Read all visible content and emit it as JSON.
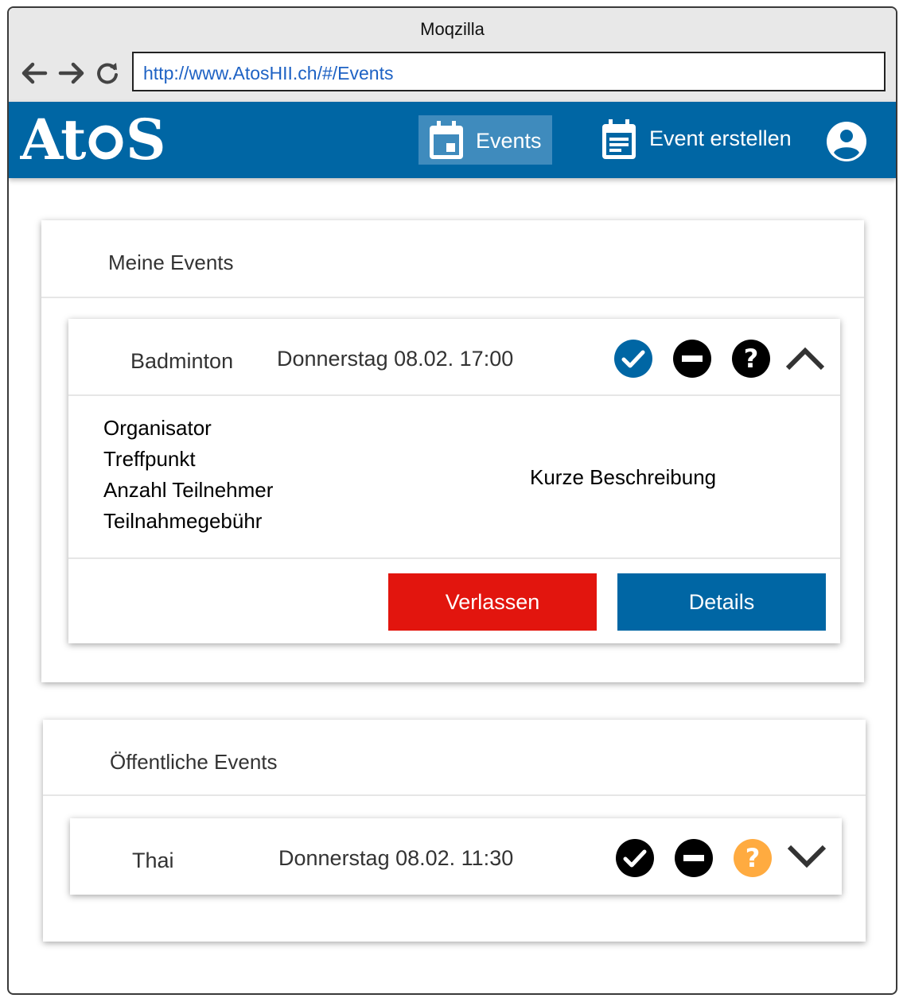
{
  "browser": {
    "title": "Moqzilla",
    "url": "http://www.AtosHII.ch/#/Events"
  },
  "app": {
    "logo_text": "AtoS",
    "nav": {
      "events_label": "Events",
      "create_label": "Event erstellen"
    },
    "colors": {
      "brand": "#0066a4",
      "active_tab": "#3f8bbd",
      "leave": "#e2150e",
      "maybe": "#ffab40"
    }
  },
  "my_events": {
    "title": "Meine Events",
    "event": {
      "name": "Badminton",
      "date": "Donnerstag 08.02. 17:00",
      "details": [
        "Organisator",
        "Treffpunkt",
        "Anzahl Teilnehmer",
        "Teilnahmegebühr"
      ],
      "description": "Kurze Beschreibung",
      "leave_label": "Verlassen",
      "details_label": "Details",
      "status": "accepted"
    }
  },
  "public_events": {
    "title": "Öffentliche Events",
    "event": {
      "name": "Thai",
      "date": "Donnerstag 08.02. 11:30",
      "status": "maybe"
    }
  }
}
